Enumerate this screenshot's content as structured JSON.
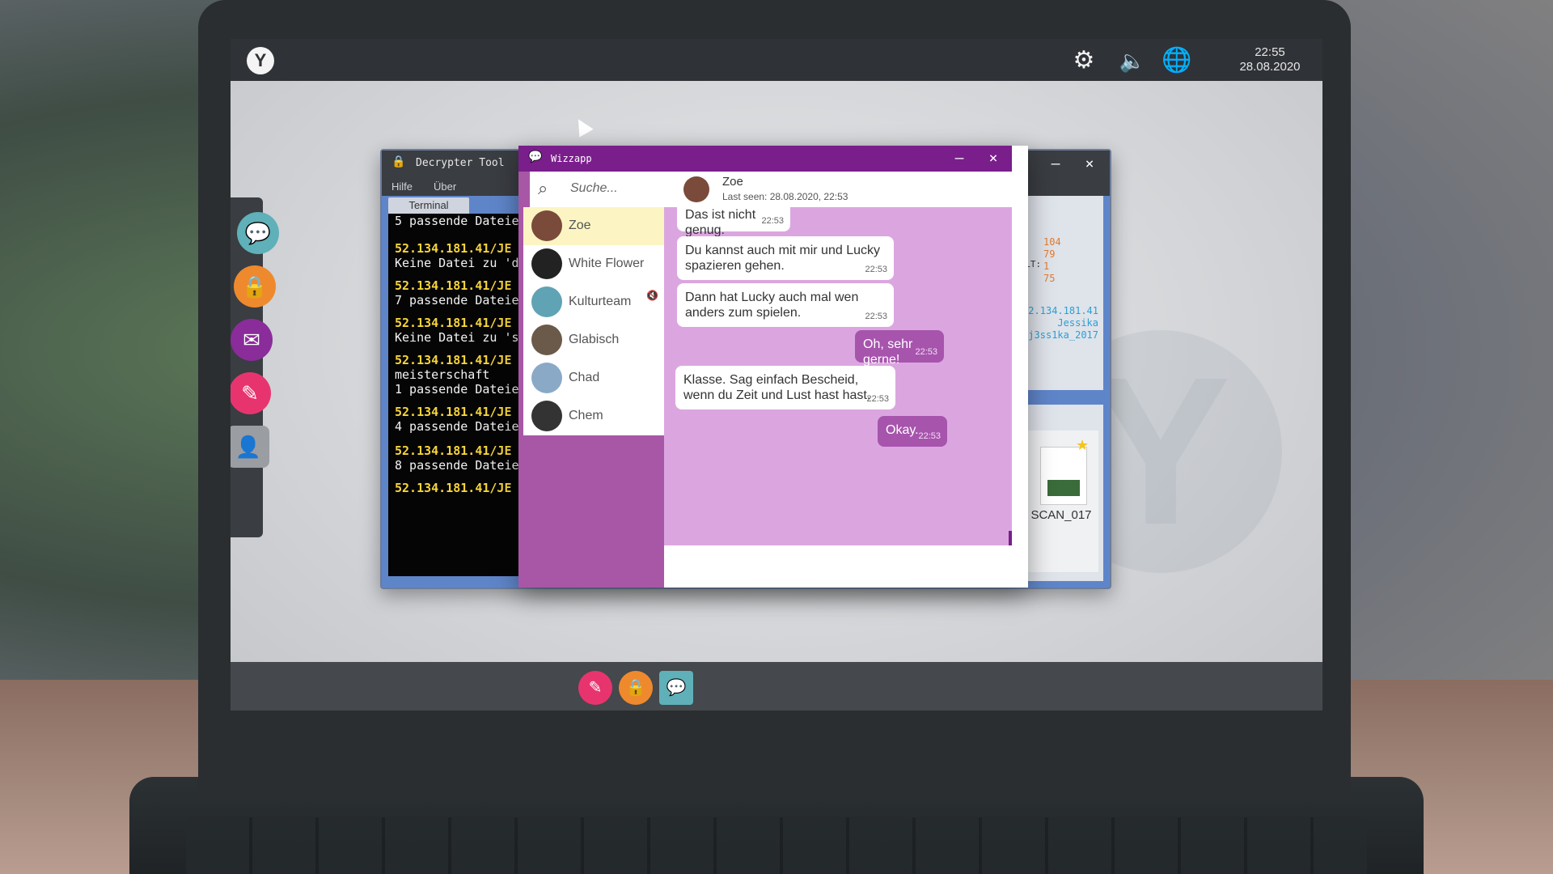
{
  "topbar": {
    "logo": "Y",
    "time": "22:55",
    "date": "28.08.2020"
  },
  "dock_icons": [
    "chat-icon",
    "lock-icon",
    "mail-icon",
    "notes-icon",
    "contacts-icon"
  ],
  "taskbar_icons": [
    "notes-icon",
    "lock-icon",
    "chat-icon"
  ],
  "decrypter": {
    "title": "Decrypter Tool",
    "menu": [
      "Hilfe",
      "Über"
    ],
    "tab": "Terminal",
    "terminal_lines": [
      {
        "text": "5 passende Dateie",
        "kind": "normal"
      },
      {
        "text": "52.134.181.41/JE",
        "kind": "ip"
      },
      {
        "text": "Keine Datei zu 'd",
        "kind": "normal"
      },
      {
        "text": "52.134.181.41/JE",
        "kind": "ip"
      },
      {
        "text": "7 passende Dateie",
        "kind": "normal"
      },
      {
        "text": "52.134.181.41/JE",
        "kind": "ip"
      },
      {
        "text": "Keine Datei zu 's",
        "kind": "normal"
      },
      {
        "text": "52.134.181.41/JE",
        "kind": "ip"
      },
      {
        "text": "meisterschaft",
        "kind": "normal"
      },
      {
        "text": "1 passende Dateie",
        "kind": "normal"
      },
      {
        "text": "52.134.181.41/JE",
        "kind": "ip"
      },
      {
        "text": "4 passende Dateie",
        "kind": "normal"
      },
      {
        "text": "52.134.181.41/JE",
        "kind": "ip"
      },
      {
        "text": "8 passende Dateie",
        "kind": "normal"
      },
      {
        "text": "52.134.181.41/JE",
        "kind": "ip"
      }
    ],
    "stats": [
      "104",
      "79",
      "1",
      "75"
    ],
    "stats_label": "ELLT:",
    "server": [
      "52.134.181.41",
      "Jessika",
      "j3ss1ka_2017"
    ],
    "file_name": "SCAN_017"
  },
  "wizzapp": {
    "title": "Wizzapp",
    "search_placeholder": "Suche...",
    "contacts": [
      {
        "name": "Zoe",
        "active": true,
        "color": "#7a4a3a"
      },
      {
        "name": "White Flower",
        "active": false,
        "color": "#222222"
      },
      {
        "name": "Kulturteam",
        "active": false,
        "color": "#5fa3b5",
        "muted": true
      },
      {
        "name": "Glabisch",
        "active": false,
        "color": "#6b5a4a"
      },
      {
        "name": "Chad",
        "active": false,
        "color": "#8aa9c7"
      },
      {
        "name": "Chem",
        "active": false,
        "color": "#333333"
      }
    ],
    "chat_header": {
      "name": "Zoe",
      "last_seen": "Last seen: 28.08.2020, 22:53"
    },
    "messages": [
      {
        "dir": "in",
        "text": "Das ist nicht genug.",
        "time": "22:53"
      },
      {
        "dir": "in",
        "text": "Du kannst auch mit mir und Lucky spazieren gehen.",
        "time": "22:53"
      },
      {
        "dir": "in",
        "text": "Dann hat Lucky auch mal wen anders zum spielen.",
        "time": "22:53"
      },
      {
        "dir": "out",
        "text": "Oh, sehr gerne!",
        "time": "22:53"
      },
      {
        "dir": "in",
        "text": "Klasse. Sag einfach Bescheid, wenn du Zeit und Lust hast hast.",
        "time": "22:53"
      },
      {
        "dir": "out",
        "text": "Okay.",
        "time": "22:53"
      }
    ]
  },
  "colors": {
    "wizz_purple": "#7a1e8c",
    "chat_bg": "#dba6e0",
    "outgoing": "#a754ad",
    "ip_yellow": "#f7d53a"
  }
}
